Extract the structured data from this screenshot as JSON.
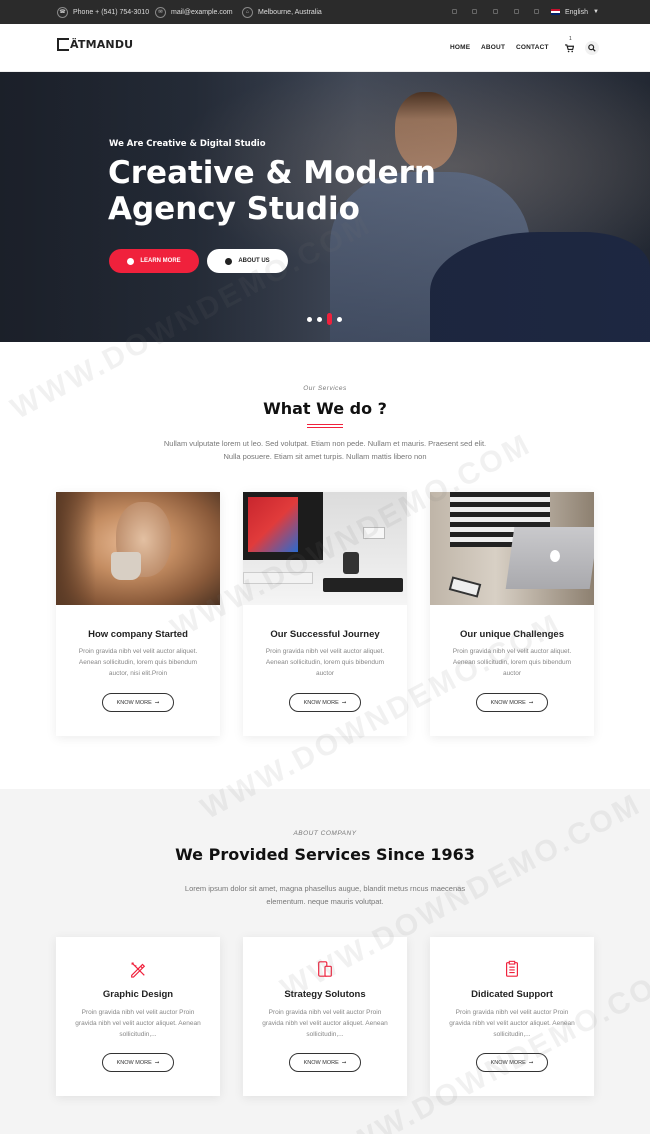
{
  "topbar": {
    "phone": "Phone + (541) 754-3010",
    "email": "mail@example.com",
    "location": "Melbourne, Australia",
    "language": "English"
  },
  "navbar": {
    "logo": "ÄTMANDU",
    "links": [
      "HOME",
      "ABOUT",
      "CONTACT"
    ],
    "cart_count": "1"
  },
  "hero": {
    "subtitle": "We Are Creative & Digital Studio",
    "title_line1": "Creative & Modern",
    "title_line2": "Agency Studio",
    "primary_button": "LEARN MORE",
    "secondary_button": "ABOUT US",
    "slides_total": 4,
    "slide_active": 3
  },
  "services": {
    "eyebrow": "Our Services",
    "title": "What We do ?",
    "description": "Nullam vulputate lorem ut leo. Sed volutpat. Etiam non pede. Nullam et mauris. Praesent sed elit. Nulla posuere. Etiam sit amet turpis. Nullam mattis libero non",
    "cards": [
      {
        "title": "How company Started",
        "text": "Proin gravida nibh vel velit auctor aliquet. Aenean sollicitudin, lorem quis bibendum auctor, nisi elit.Proin",
        "button": "KNOW MORE"
      },
      {
        "title": "Our Successful Journey",
        "text": "Proin gravida nibh vel velit auctor aliquet. Aenean sollicitudin, lorem quis bibendum auctor",
        "button": "KNOW MORE"
      },
      {
        "title": "Our unique Challenges",
        "text": "Proin gravida nibh vel velit auctor aliquet. Aenean sollicitudin, lorem quis bibendum auctor",
        "button": "KNOW MORE"
      }
    ]
  },
  "about": {
    "eyebrow": "ABOUT COMPANY",
    "title": "We Provided Services Since 1963",
    "description": "Lorem ipsum dolor sit amet, magna phasellus augue, blandit metus rncus maecenas elementum. neque mauris volutpat.",
    "features": [
      {
        "icon": "pencil-ruler-icon",
        "title": "Graphic Design",
        "text": "Proin gravida nibh vel velit auctor Proin gravida nibh vel velit auctor aliquet. Aenean sollicitudin,...",
        "button": "KNOW MORE"
      },
      {
        "icon": "mobile-tablet-icon",
        "title": "Strategy Solutons",
        "text": "Proin gravida nibh vel velit auctor Proin gravida nibh vel velit auctor aliquet. Aenean sollicitudin,...",
        "button": "KNOW MORE"
      },
      {
        "icon": "clipboard-icon",
        "title": "Didicated Support",
        "text": "Proin gravida nibh vel velit auctor Proin gravida nibh vel velit auctor aliquet. Aenean sollicitudin,...",
        "button": "KNOW MORE"
      }
    ]
  },
  "watermark": "WWW.DOWNDEMO.COM",
  "colors": {
    "accent": "#f0213c",
    "topbar": "#2b2b2b",
    "section_bg": "#f4f4f4"
  }
}
